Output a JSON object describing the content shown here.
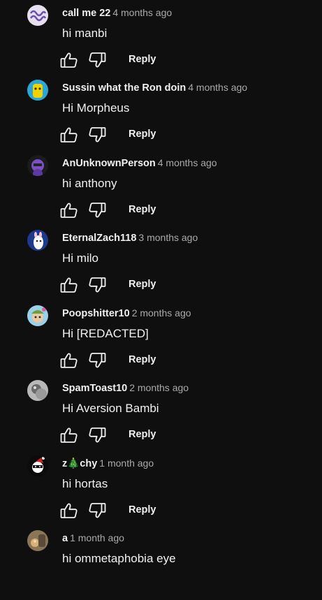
{
  "reply_label": "Reply",
  "comments": [
    {
      "author": "call me 22",
      "time": "4 months ago",
      "text": "hi manbi",
      "avatar": {
        "icon": "swirl-logo-avatar-icon",
        "bg": "#e6e0ee",
        "fg": "#6a4fb0"
      }
    },
    {
      "author": "Sussin what the Ron doin",
      "time": "4 months ago",
      "text": "Hi Morpheus",
      "avatar": {
        "icon": "yellow-character-avatar-icon",
        "bg": "#2aa7d6",
        "fg": "#f2d300"
      }
    },
    {
      "author": "AnUnknownPerson",
      "time": "4 months ago",
      "text": "hi anthony",
      "avatar": {
        "icon": "purple-character-avatar-icon",
        "bg": "#1b1b1b",
        "fg": "#7b4fc9"
      }
    },
    {
      "author": "EternalZach118",
      "time": "3 months ago",
      "text": "Hi milo",
      "avatar": {
        "icon": "llama-avatar-icon",
        "bg": "#1f3a8a",
        "fg": "#ffffff"
      }
    },
    {
      "author": "Poopshitter10",
      "time": "2 months ago",
      "text": "Hi [REDACTED]",
      "avatar": {
        "icon": "cartoon-avatar-icon",
        "bg": "#9ad1e8",
        "fg": "#6f9f3a"
      }
    },
    {
      "author": "SpamToast10",
      "time": "2 months ago",
      "text": "Hi Aversion Bambi",
      "avatar": {
        "icon": "gray-photo-avatar-icon",
        "bg": "#b8b8b8",
        "fg": "#6a6a6a"
      }
    },
    {
      "author": "z🎄chy",
      "time": "1 month ago",
      "text": "hi hortas",
      "avatar": {
        "icon": "ninja-santa-avatar-icon",
        "bg": "#0b0b0b",
        "fg": "#d21f1f"
      }
    },
    {
      "author": "a",
      "time": "1 month ago",
      "text": "hi ommetaphobia eye",
      "avatar": {
        "icon": "photo-avatar-icon",
        "bg": "#8a7558",
        "fg": "#d8b07a"
      }
    }
  ]
}
